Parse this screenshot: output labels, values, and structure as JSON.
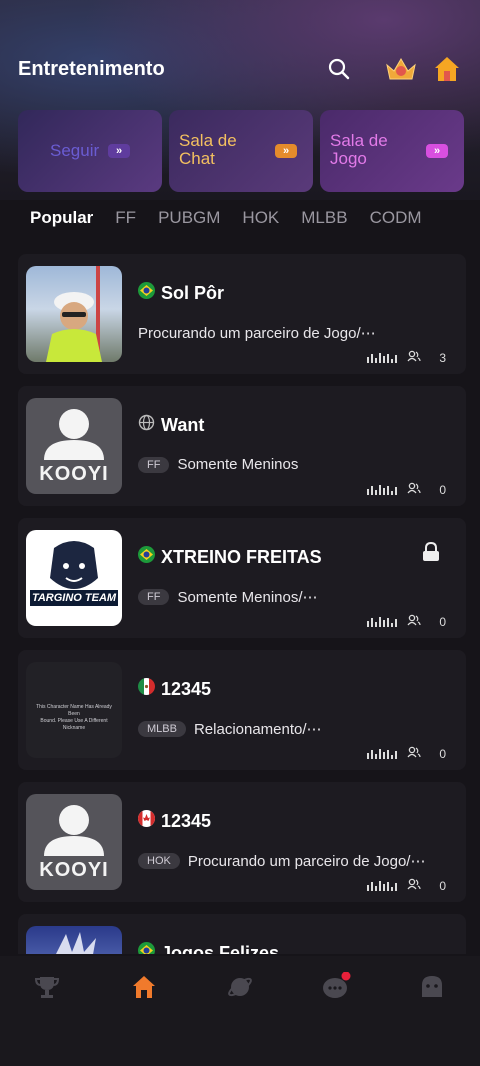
{
  "header": {
    "title": "Entretenimento",
    "icons": [
      "search-icon",
      "rank-badge-icon",
      "home-room-icon"
    ]
  },
  "banners": [
    {
      "label": "Seguir",
      "color": "#5f3c9e"
    },
    {
      "label": "Sala de Chat",
      "color": "#e58b2b"
    },
    {
      "label": "Sala de Jogo",
      "color": "#d84fe0"
    }
  ],
  "tabs": [
    "Popular",
    "FF",
    "PUBGM",
    "HOK",
    "MLBB",
    "CODM"
  ],
  "rooms": [
    {
      "name": "Sol Pôr",
      "flag": "brazil",
      "tag": "",
      "desc": "Procurando um parceiro de Jogo/⋯",
      "count": "3",
      "locked": false
    },
    {
      "name": "Want",
      "flag": "globe",
      "tag": "FF",
      "desc": "Somente Meninos",
      "count": "0",
      "locked": false
    },
    {
      "name": "XTREINO FREITAS",
      "flag": "brazil",
      "tag": "FF",
      "desc": "Somente Meninos/⋯",
      "count": "0",
      "locked": true,
      "avatar_text": "TARGINO TEAM"
    },
    {
      "name": "12345",
      "flag": "mexico",
      "tag": "MLBB",
      "desc": "Relacionamento/⋯",
      "count": "0",
      "locked": false,
      "avatar_text_lines": [
        "This Character Name Has Already Been",
        "Bound. Please Use A Different Nickname"
      ]
    },
    {
      "name": "12345",
      "flag": "canada",
      "tag": "HOK",
      "desc": "Procurando um parceiro de Jogo/⋯",
      "count": "0",
      "locked": false
    },
    {
      "name": "Jogos Felizes",
      "flag": "brazil",
      "tag": "",
      "desc": "",
      "count": "",
      "locked": false
    }
  ],
  "avatar_logo": "KOOYI",
  "nav": {
    "items": [
      "trophy-icon",
      "home-icon",
      "planet-icon",
      "chat-icon",
      "profile-icon"
    ],
    "active_color": "#f07a2c"
  }
}
